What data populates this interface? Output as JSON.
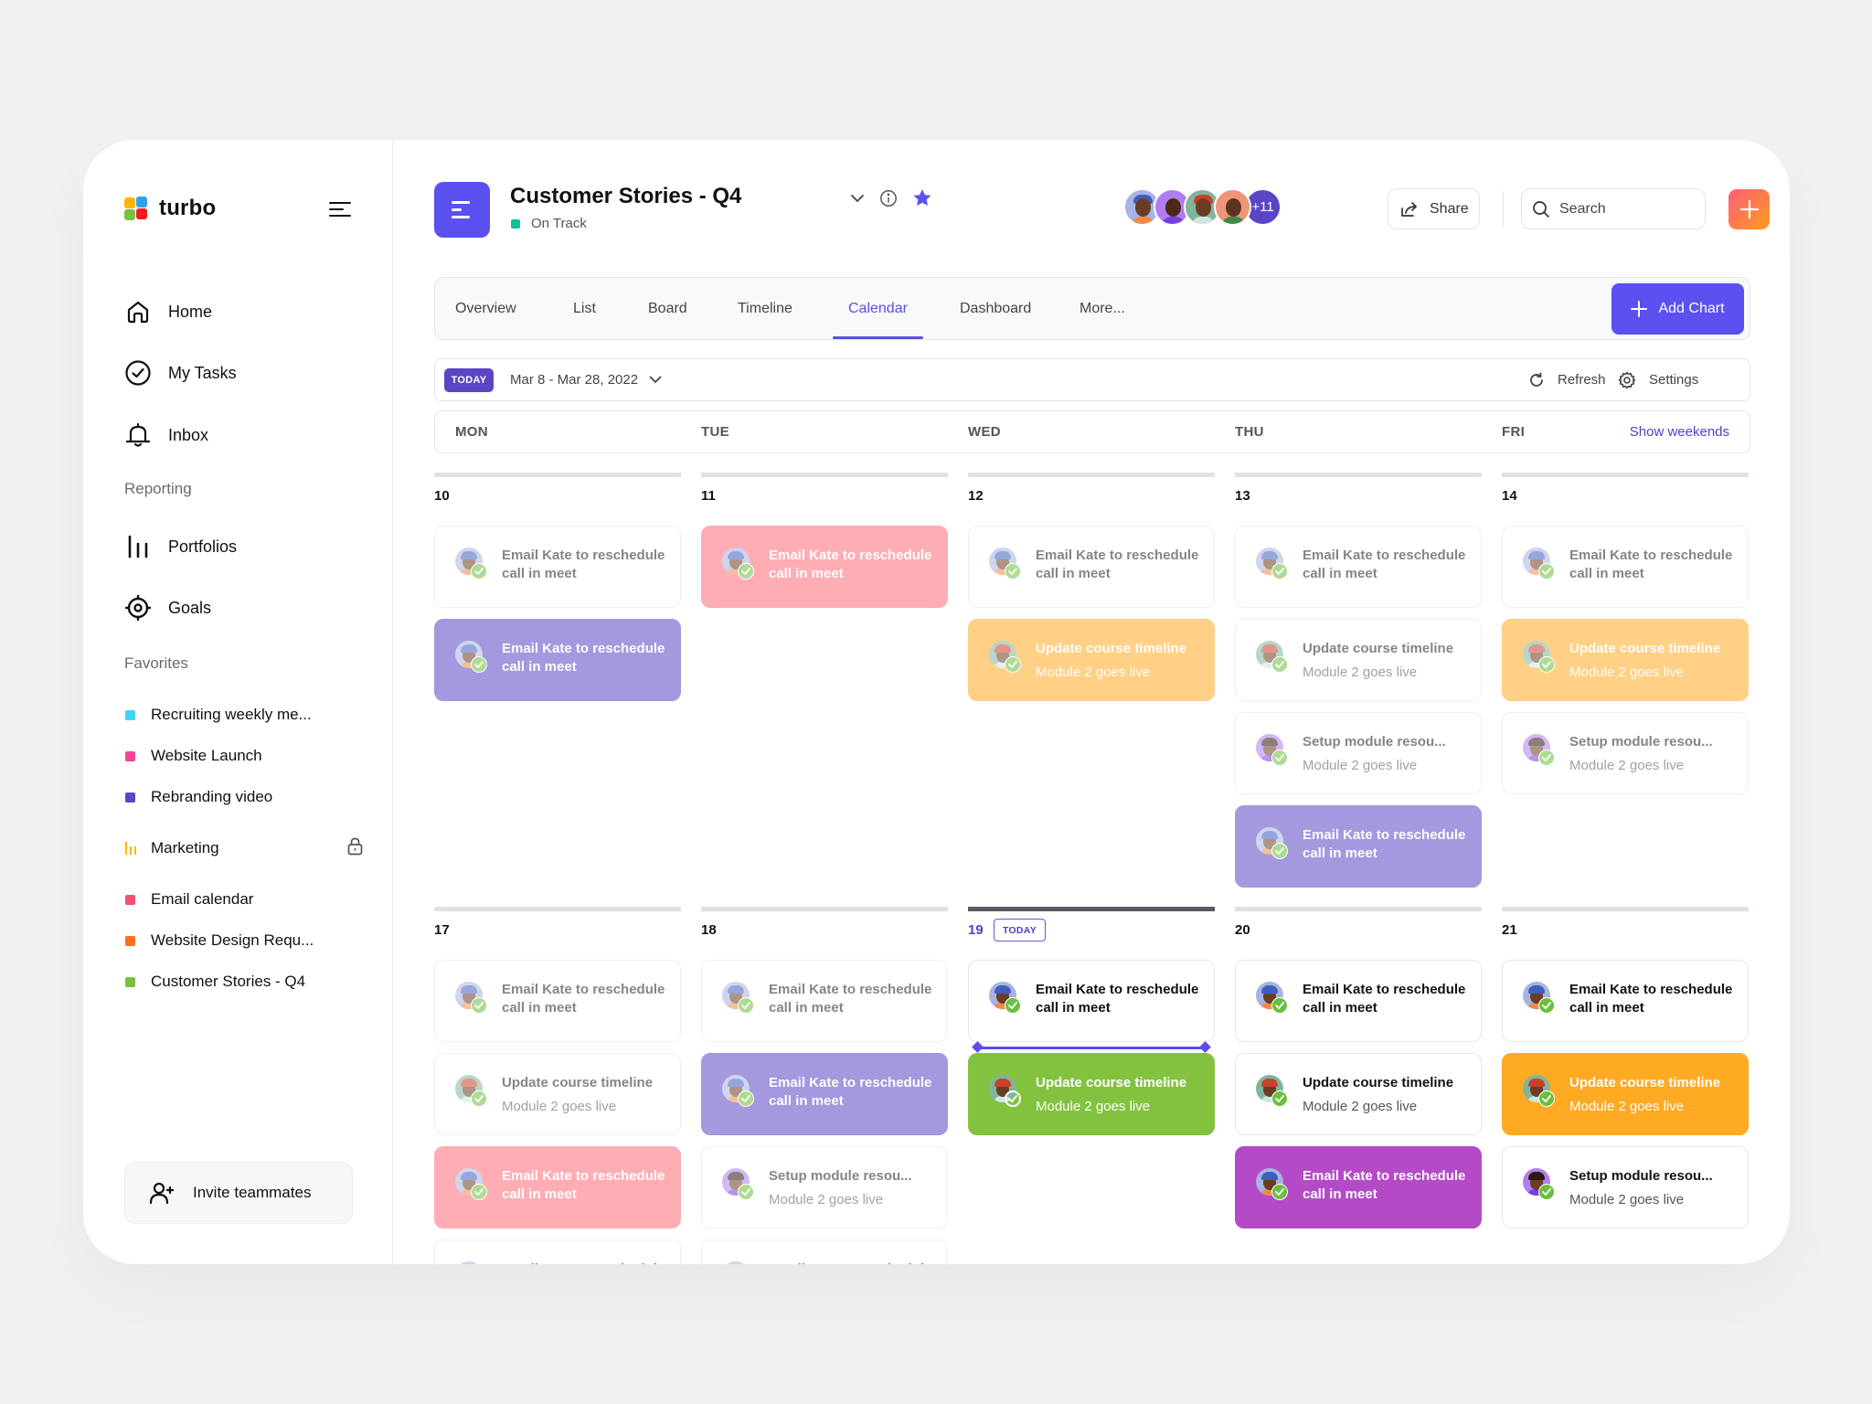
{
  "app": {
    "name": "turbo",
    "logo_colors": [
      "#ffb400",
      "#2ea3ea",
      "#7ac142",
      "#f21c1c"
    ]
  },
  "sidebar": {
    "nav": [
      {
        "label": "Home",
        "icon": "home-icon"
      },
      {
        "label": "My Tasks",
        "icon": "check-circle-icon"
      },
      {
        "label": "Inbox",
        "icon": "bell-icon"
      }
    ],
    "reporting_label": "Reporting",
    "reporting": [
      {
        "label": "Portfolios",
        "icon": "bar-chart-icon"
      },
      {
        "label": "Goals",
        "icon": "target-icon"
      }
    ],
    "favorites_label": "Favorites",
    "favorites": [
      {
        "label": "Recruiting weekly me...",
        "color": "#3dd5f3"
      },
      {
        "label": "Website Launch",
        "color": "#f2449a"
      },
      {
        "label": "Rebranding video",
        "color": "#5b45c4"
      },
      {
        "label": "Marketing",
        "color": "#ffb400",
        "icon": "bar-chart-icon",
        "locked": true
      },
      {
        "label": "Email calendar",
        "color": "#f5506e"
      },
      {
        "label": "Website Design Requ...",
        "color": "#ff6d1f"
      },
      {
        "label": "Customer Stories - Q4",
        "color": "#7ac142"
      }
    ],
    "invite_label": "Invite teammates"
  },
  "header": {
    "project_title": "Customer Stories - Q4",
    "status": "On Track",
    "status_color": "#12bf9a",
    "starred": true,
    "members_more": "+11",
    "share_label": "Share",
    "search_placeholder": "Search"
  },
  "tabs": {
    "items": [
      "Overview",
      "List",
      "Board",
      "Timeline",
      "Calendar",
      "Dashboard",
      "More..."
    ],
    "active": "Calendar",
    "add_chart_label": "Add Chart"
  },
  "toolbar": {
    "today_label": "TODAY",
    "date_range": "Mar 8 - Mar 28, 2022",
    "refresh_label": "Refresh",
    "settings_label": "Settings"
  },
  "calendar": {
    "weekdays": [
      "MON",
      "TUE",
      "WED",
      "THU",
      "FRI"
    ],
    "show_weekends_label": "Show weekends",
    "today_badge": "TODAY",
    "weeks": [
      {
        "days": [
          {
            "date": "10",
            "tasks": [
              {
                "title": "Email Kate to reschedule call in meet",
                "color": "white",
                "faded": true
              },
              {
                "title": "Email Kate to reschedule call in meet",
                "color": "purple",
                "faded": true
              }
            ]
          },
          {
            "date": "11",
            "tasks": [
              {
                "title": "Email Kate to reschedule call in meet",
                "color": "pink",
                "faded": true
              }
            ]
          },
          {
            "date": "12",
            "tasks": [
              {
                "title": "Email Kate to reschedule call in meet",
                "color": "white",
                "faded": true
              },
              {
                "title": "Update course timeline",
                "subtitle": "Module 2 goes live",
                "color": "orange",
                "faded": true
              }
            ]
          },
          {
            "date": "13",
            "tasks": [
              {
                "title": "Email Kate to reschedule call in meet",
                "color": "white",
                "faded": true
              },
              {
                "title": "Update course timeline",
                "subtitle": "Module 2 goes live",
                "color": "white",
                "faded": true
              },
              {
                "title": "Setup module resou...",
                "subtitle": "Module 2 goes live",
                "color": "white",
                "faded": true
              },
              {
                "title": "Email Kate to reschedule call in meet",
                "color": "purple",
                "faded": true
              }
            ]
          },
          {
            "date": "14",
            "tasks": [
              {
                "title": "Email Kate to reschedule call in meet",
                "color": "white",
                "faded": true
              },
              {
                "title": "Update course timeline",
                "subtitle": "Module 2 goes live",
                "color": "orange",
                "faded": true
              },
              {
                "title": "Setup module resou...",
                "subtitle": "Module 2 goes live",
                "color": "white",
                "faded": true
              }
            ]
          }
        ]
      },
      {
        "days": [
          {
            "date": "17",
            "tasks": [
              {
                "title": "Email Kate to reschedule call in meet",
                "color": "white",
                "faded": true
              },
              {
                "title": "Update course timeline",
                "subtitle": "Module 2 goes live",
                "color": "white",
                "faded": true
              },
              {
                "title": "Email Kate to reschedule call in meet",
                "color": "pink",
                "faded": true
              },
              {
                "title": "Email Kate to reschedule call in meet",
                "color": "white",
                "faded": true
              }
            ]
          },
          {
            "date": "18",
            "tasks": [
              {
                "title": "Email Kate to reschedule call in meet",
                "color": "white",
                "faded": true
              },
              {
                "title": "Email Kate to reschedule call in meet",
                "color": "purple",
                "faded": true
              },
              {
                "title": "Setup module resou...",
                "subtitle": "Module 2 goes live",
                "color": "white",
                "faded": true
              },
              {
                "title": "Email Kate to reschedule call in meet",
                "color": "white",
                "faded": true
              }
            ]
          },
          {
            "date": "19",
            "today": true,
            "tasks": [
              {
                "title": "Email Kate to reschedule call in meet",
                "color": "white",
                "faded": false
              },
              {
                "title": "Update course timeline",
                "subtitle": "Module 2 goes live",
                "color": "green",
                "faded": false,
                "drop_indicator": true
              }
            ]
          },
          {
            "date": "20",
            "tasks": [
              {
                "title": "Email Kate to reschedule call in meet",
                "color": "white",
                "faded": false
              },
              {
                "title": "Update course timeline",
                "subtitle": "Module 2 goes live",
                "color": "white",
                "faded": false
              },
              {
                "title": "Email Kate to reschedule call in meet",
                "color": "magenta",
                "faded": false
              }
            ]
          },
          {
            "date": "21",
            "tasks": [
              {
                "title": "Email Kate to reschedule call in meet",
                "color": "white",
                "faded": false
              },
              {
                "title": "Update course timeline",
                "subtitle": "Module 2 goes live",
                "color": "orange",
                "faded": false
              },
              {
                "title": "Setup module resou...",
                "subtitle": "Module 2 goes live",
                "color": "white",
                "faded": false
              }
            ]
          }
        ]
      }
    ]
  }
}
